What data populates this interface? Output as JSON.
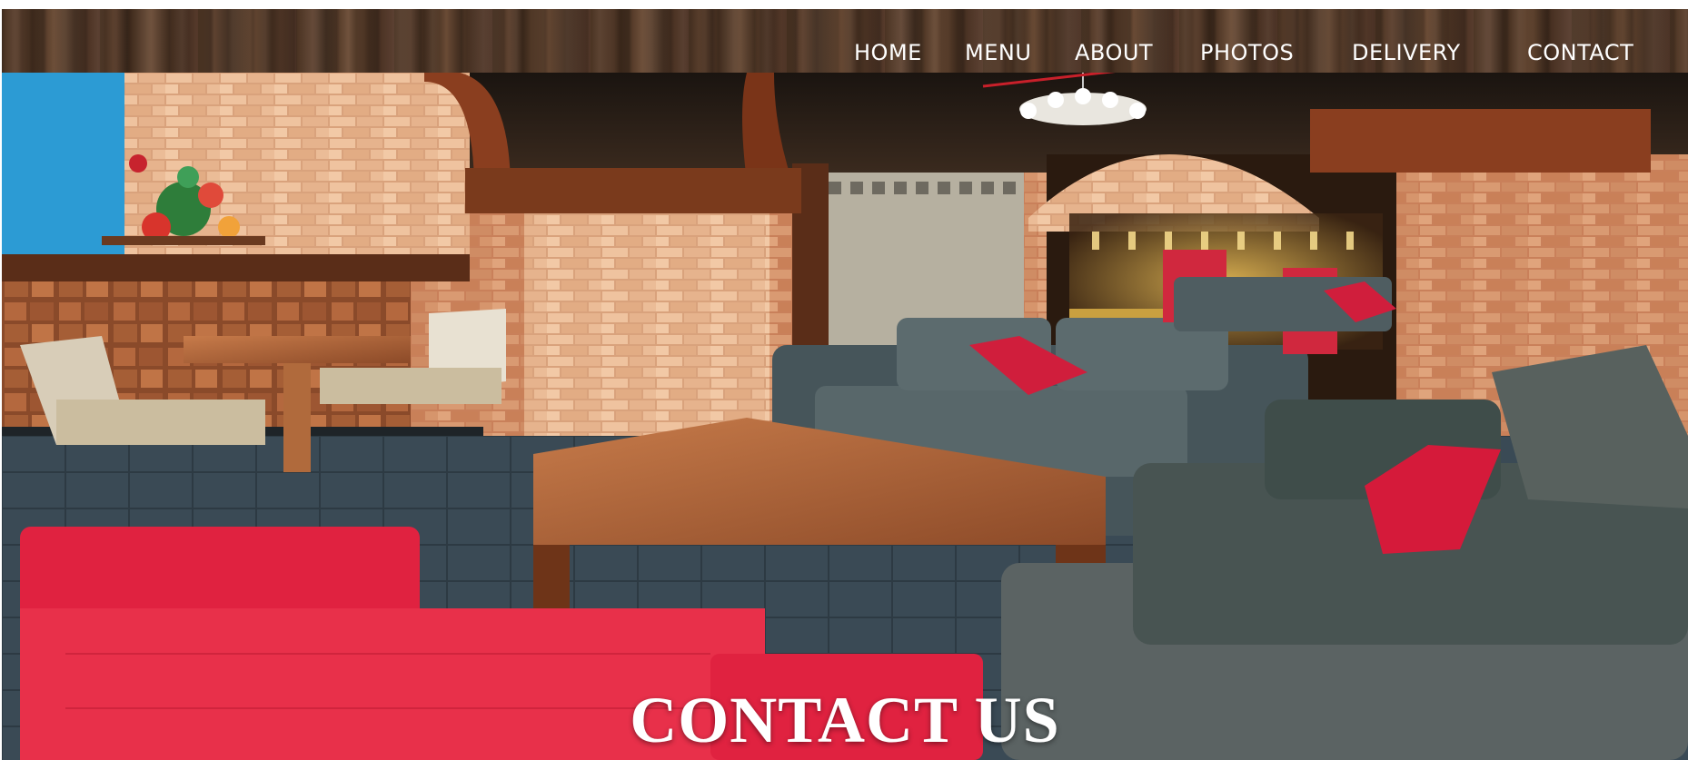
{
  "nav": {
    "items": [
      {
        "label": "HOME"
      },
      {
        "label": "MENU"
      },
      {
        "label": "ABOUT"
      },
      {
        "label": "PHOTOS"
      },
      {
        "label": "DELIVERY"
      },
      {
        "label": "CONTACT"
      }
    ]
  },
  "hero": {
    "title": "CONTACT US"
  }
}
